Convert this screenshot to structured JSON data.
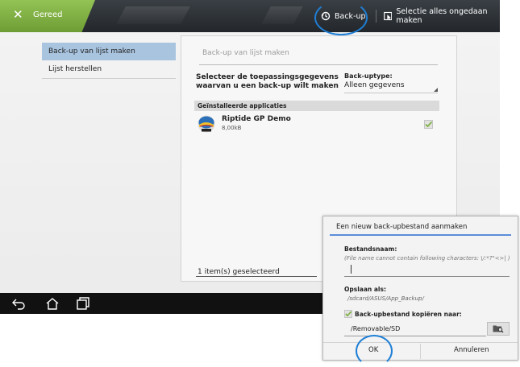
{
  "actionbar": {
    "done_label": "Gereed",
    "backup_label": "Back-up",
    "deselect_label": "Selectie alles ongedaan maken",
    "done_icon": "close-icon",
    "backup_icon": "history-icon",
    "deselect_icon": "deselect-icon"
  },
  "sidebar": {
    "items": [
      {
        "label": "Back-up van lijst maken",
        "active": true
      },
      {
        "label": "Lijst herstellen",
        "active": false
      }
    ]
  },
  "panel": {
    "title": "Back-up van lijst maken",
    "select_hint": "Selecteer de toepassingsgegevens waarvan u een back-up wilt maken",
    "backup_type_label": "Back-uptype:",
    "backup_type_value": "Alleen gegevens",
    "section_header": "Geïnstalleerde applicaties",
    "apps": [
      {
        "name": "Riptide GP Demo",
        "size": "8,00kB",
        "checked": true
      }
    ],
    "selected_count": "1 item(s) geselecteerd"
  },
  "navbar": {
    "icons": [
      "back-icon",
      "home-icon",
      "recent-apps-icon"
    ]
  },
  "dialog": {
    "title": "Een nieuw back-upbestand aanmaken",
    "filename_label": "Bestandsnaam:",
    "filename_hint": "(File name cannot contain following characters: \\/:*?\"<>| )",
    "filename_value": "",
    "save_as_label": "Opslaan als:",
    "save_as_path": "/sdcard/ASUS/App_Backup/",
    "copy_label": "Back-upbestand kopiëren naar:",
    "copy_checked": true,
    "destination": "/Removable/SD",
    "ok_label": "OK",
    "cancel_label": "Annuleren"
  },
  "colors": {
    "accent_green": "#7fb043",
    "selection_blue": "#a9c4df",
    "highlight_circle": "#1f7fd6",
    "dialog_rule": "#5b8ed8"
  }
}
